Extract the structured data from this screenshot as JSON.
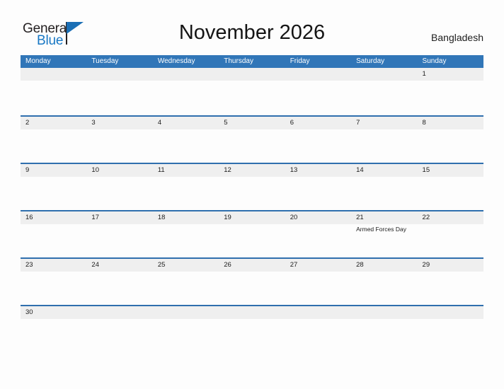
{
  "brand": {
    "name_part1": "General",
    "name_part2": "Blue",
    "flag_icon": "triangle-flag-icon",
    "colors": {
      "dark": "#231f20",
      "blue": "#1878c4",
      "flag": "#1b6fb5"
    }
  },
  "header": {
    "title": "November 2026",
    "country": "Bangladesh"
  },
  "theme": {
    "header_blue": "#3176b8",
    "row_rule_blue": "#2f6fae",
    "band_gray": "#efefef",
    "page_bg": "#fdfdfd",
    "text": "#1c1c1c"
  },
  "calendar": {
    "month": "November",
    "year": "2026",
    "weekday_headers": [
      "Monday",
      "Tuesday",
      "Wednesday",
      "Thursday",
      "Friday",
      "Saturday",
      "Sunday"
    ],
    "weeks": [
      {
        "days": [
          {
            "num": "",
            "events": []
          },
          {
            "num": "",
            "events": []
          },
          {
            "num": "",
            "events": []
          },
          {
            "num": "",
            "events": []
          },
          {
            "num": "",
            "events": []
          },
          {
            "num": "",
            "events": []
          },
          {
            "num": "1",
            "events": []
          }
        ]
      },
      {
        "days": [
          {
            "num": "2",
            "events": []
          },
          {
            "num": "3",
            "events": []
          },
          {
            "num": "4",
            "events": []
          },
          {
            "num": "5",
            "events": []
          },
          {
            "num": "6",
            "events": []
          },
          {
            "num": "7",
            "events": []
          },
          {
            "num": "8",
            "events": []
          }
        ]
      },
      {
        "days": [
          {
            "num": "9",
            "events": []
          },
          {
            "num": "10",
            "events": []
          },
          {
            "num": "11",
            "events": []
          },
          {
            "num": "12",
            "events": []
          },
          {
            "num": "13",
            "events": []
          },
          {
            "num": "14",
            "events": []
          },
          {
            "num": "15",
            "events": []
          }
        ]
      },
      {
        "days": [
          {
            "num": "16",
            "events": []
          },
          {
            "num": "17",
            "events": []
          },
          {
            "num": "18",
            "events": []
          },
          {
            "num": "19",
            "events": []
          },
          {
            "num": "20",
            "events": []
          },
          {
            "num": "21",
            "events": [
              "Armed Forces Day"
            ]
          },
          {
            "num": "22",
            "events": []
          }
        ]
      },
      {
        "days": [
          {
            "num": "23",
            "events": []
          },
          {
            "num": "24",
            "events": []
          },
          {
            "num": "25",
            "events": []
          },
          {
            "num": "26",
            "events": []
          },
          {
            "num": "27",
            "events": []
          },
          {
            "num": "28",
            "events": []
          },
          {
            "num": "29",
            "events": []
          }
        ]
      },
      {
        "days": [
          {
            "num": "30",
            "events": []
          },
          {
            "num": "",
            "events": []
          },
          {
            "num": "",
            "events": []
          },
          {
            "num": "",
            "events": []
          },
          {
            "num": "",
            "events": []
          },
          {
            "num": "",
            "events": []
          },
          {
            "num": "",
            "events": []
          }
        ]
      }
    ]
  }
}
